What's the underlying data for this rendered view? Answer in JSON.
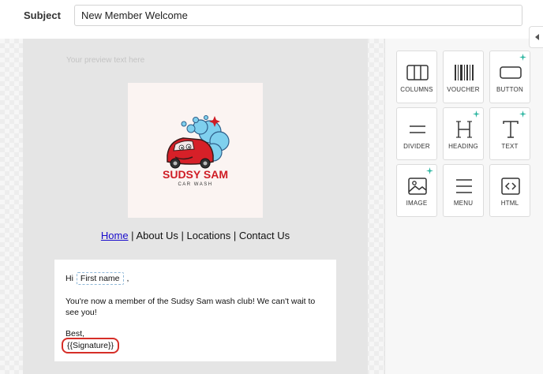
{
  "subject": {
    "label": "Subject",
    "value": "New Member Welcome"
  },
  "email": {
    "preview_text": "Your preview text here",
    "logo": {
      "brand_name": "SUDSY SAM",
      "brand_sub": "CAR WASH"
    },
    "nav": {
      "home": "Home",
      "sep1": " | ",
      "about": "About Us",
      "sep2": " | ",
      "locations": "Locations",
      "sep3": " | ",
      "contact": "Contact Us"
    },
    "content": {
      "hi": "Hi",
      "first_name_tag": "First name",
      "comma": ",",
      "message": "You're now a member of the Sudsy Sam wash club! We can't wait to see you!",
      "closing": "Best,",
      "signature_tag": "{{Signature}}"
    }
  },
  "blocks": [
    {
      "label": "COLUMNS",
      "icon": "columns-icon",
      "ai": false
    },
    {
      "label": "VOUCHER",
      "icon": "barcode-icon",
      "ai": false
    },
    {
      "label": "BUTTON",
      "icon": "button-icon",
      "ai": true
    },
    {
      "label": "DIVIDER",
      "icon": "divider-icon",
      "ai": false
    },
    {
      "label": "HEADING",
      "icon": "heading-icon",
      "ai": true
    },
    {
      "label": "TEXT",
      "icon": "text-icon",
      "ai": true
    },
    {
      "label": "IMAGE",
      "icon": "image-icon",
      "ai": true
    },
    {
      "label": "MENU",
      "icon": "menu-icon",
      "ai": false
    },
    {
      "label": "HTML",
      "icon": "html-code-icon",
      "ai": false
    }
  ],
  "colors": {
    "accent_red": "#d62e28",
    "brand_red": "#cf1d25",
    "bubble_blue": "#7fd0ee",
    "ai_sparkle": "#2bb5a0"
  }
}
